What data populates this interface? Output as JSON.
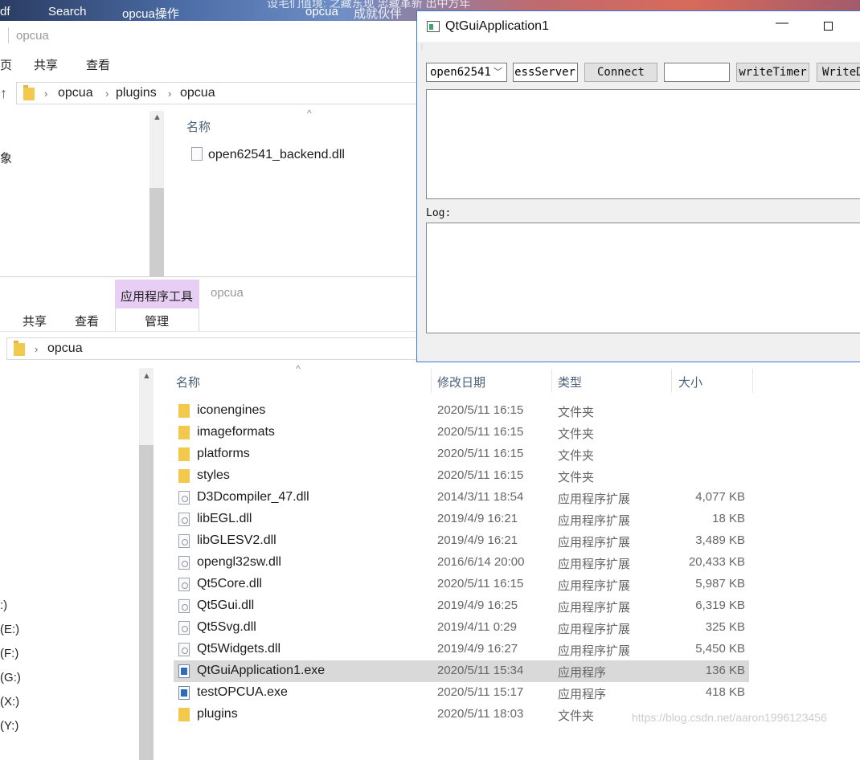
{
  "taskbar": {
    "items": [
      "df",
      "Search",
      "opcua操作",
      "opcua"
    ],
    "bg_text_1": "设毛们值境: 之藏东现 忠藏革新 出中方年",
    "bg_text_2": "成就伙伴",
    "bg_text_3": "吧"
  },
  "explorer_top": {
    "title": "opcua",
    "ribbon": [
      "页",
      "共享",
      "查看"
    ],
    "breadcrumb": [
      "opcua",
      "plugins",
      "opcua"
    ],
    "nav_item": "象",
    "column_name": "名称",
    "files": [
      {
        "name": "open62541_backend.dll",
        "icon": "dll-file-icon"
      }
    ]
  },
  "explorer_bottom": {
    "tab_tools": "应用程序工具",
    "title": "opcua",
    "ribbon": [
      "共享",
      "查看"
    ],
    "tab_manage": "管理",
    "breadcrumb": [
      "opcua"
    ],
    "columns": {
      "name": "名称",
      "date": "修改日期",
      "type": "类型",
      "size": "大小"
    },
    "drives": [
      ":)",
      "(E:)",
      "(F:)",
      "(G:)",
      "(X:)",
      "(Y:)"
    ],
    "files": [
      {
        "name": "iconengines",
        "date": "2020/5/11 16:15",
        "type": "文件夹",
        "size": "",
        "icon": "folder"
      },
      {
        "name": "imageformats",
        "date": "2020/5/11 16:15",
        "type": "文件夹",
        "size": "",
        "icon": "folder"
      },
      {
        "name": "platforms",
        "date": "2020/5/11 16:15",
        "type": "文件夹",
        "size": "",
        "icon": "folder"
      },
      {
        "name": "styles",
        "date": "2020/5/11 16:15",
        "type": "文件夹",
        "size": "",
        "icon": "folder"
      },
      {
        "name": "D3Dcompiler_47.dll",
        "date": "2014/3/11 18:54",
        "type": "应用程序扩展",
        "size": "4,077 KB",
        "icon": "dll"
      },
      {
        "name": "libEGL.dll",
        "date": "2019/4/9 16:21",
        "type": "应用程序扩展",
        "size": "18 KB",
        "icon": "dll"
      },
      {
        "name": "libGLESV2.dll",
        "date": "2019/4/9 16:21",
        "type": "应用程序扩展",
        "size": "3,489 KB",
        "icon": "dll"
      },
      {
        "name": "opengl32sw.dll",
        "date": "2016/6/14 20:00",
        "type": "应用程序扩展",
        "size": "20,433 KB",
        "icon": "dll"
      },
      {
        "name": "Qt5Core.dll",
        "date": "2020/5/11 16:15",
        "type": "应用程序扩展",
        "size": "5,987 KB",
        "icon": "dll"
      },
      {
        "name": "Qt5Gui.dll",
        "date": "2019/4/9 16:25",
        "type": "应用程序扩展",
        "size": "6,319 KB",
        "icon": "dll"
      },
      {
        "name": "Qt5Svg.dll",
        "date": "2019/4/11 0:29",
        "type": "应用程序扩展",
        "size": "325 KB",
        "icon": "dll"
      },
      {
        "name": "Qt5Widgets.dll",
        "date": "2019/4/9 16:27",
        "type": "应用程序扩展",
        "size": "5,450 KB",
        "icon": "dll"
      },
      {
        "name": "QtGuiApplication1.exe",
        "date": "2020/5/11 15:34",
        "type": "应用程序",
        "size": "136 KB",
        "icon": "exe",
        "selected": true
      },
      {
        "name": "testOPCUA.exe",
        "date": "2020/5/11 15:17",
        "type": "应用程序",
        "size": "418 KB",
        "icon": "exe"
      },
      {
        "name": "plugins",
        "date": "2020/5/11 18:03",
        "type": "文件夹",
        "size": "",
        "icon": "folder"
      }
    ],
    "watermark": "https://blog.csdn.net/aaron1996123456"
  },
  "qt_app": {
    "title": "QtGuiApplication1",
    "backend_select": "open62541",
    "server_field": "cessServer",
    "connect_label": "Connect",
    "value_field": "",
    "write_timer_label": "writeTimer",
    "write_d_label": "WriteD",
    "log_label": "Log:"
  }
}
